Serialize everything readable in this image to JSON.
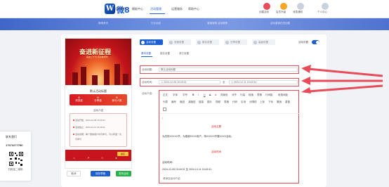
{
  "brand": {
    "logo_letter": "W",
    "logo_text": "微8"
  },
  "nav": {
    "items": [
      "用户首页",
      "模板中心",
      "活动管理",
      "运营服务",
      "帮助中心"
    ],
    "active": "活动管理"
  },
  "top_icons": [
    {
      "label": "创建活动",
      "icon": "gift-icon",
      "color": "#e84b5a"
    },
    {
      "label": "会员升级",
      "icon": "crown-icon",
      "color": "#f5a623"
    },
    {
      "label": "消息通知",
      "icon": "bell-icon",
      "color": "#9aa6b8"
    },
    {
      "label": "个人中心",
      "icon": "user-icon",
      "color": "#9aa6b8"
    }
  ],
  "banner_texts": [
    "新闻资讯",
    "行业动态",
    "营销案例 活动推荐",
    "活动营销在线创建"
  ],
  "preview": {
    "poster_title": "奋进新征程",
    "poster_subtitle": "喜迎二十大 共享新时代",
    "activity_title": "默认活动标题",
    "stats": [
      {
        "num": "0",
        "label": "浏览量"
      },
      {
        "num": "0",
        "label": "分享量"
      },
      {
        "num": "0",
        "label": "参与人数"
      }
    ],
    "section_title": "活动介绍",
    "info_lines": [
      "活动开始：2024-12-05 15:49:31",
      "活动截止：2024-12-11 15:49:31",
      "活动说明：每个微信用户均可参与，可以转发一次",
      "可参与"
    ],
    "footer_button": "报名",
    "footer_icons": [
      "home-icon",
      "share-icon",
      "star-icon",
      "user-icon"
    ]
  },
  "buttons": {
    "cancel": "取消",
    "save_draft": "保存草稿",
    "publish": "发布活动"
  },
  "steps": [
    {
      "label": "活动设置",
      "active": true
    },
    {
      "label": "页面设置",
      "active": false
    },
    {
      "label": "报名设置",
      "active": false
    },
    {
      "label": "分享设置",
      "active": false
    },
    {
      "label": "高级设置",
      "active": false
    }
  ],
  "switch_label": "活动设置",
  "subtabs": [
    "基本设置",
    "报名设置",
    "其它设置"
  ],
  "form": {
    "title_label": "活动标题：",
    "title_value": "默认活动标题",
    "time_label": "活动时间：",
    "start_time": "2024-12-05 15:49:31",
    "time_separator": "至",
    "end_time": "2024-12-11 15:49:31",
    "intro_label": "活动介绍："
  },
  "editor": {
    "toolbar_row1": [
      "正文",
      "字体",
      "字号",
      "B",
      "I",
      "U",
      "S",
      "A",
      "背景色",
      "对齐",
      "行高",
      "段落",
      "表情",
      "行间距",
      "段落间距"
    ],
    "toolbar_row2": [
      "列表",
      "编号",
      "缩进",
      "减缩进",
      "链接",
      "图片",
      "视频",
      "表格",
      "代码",
      "引用",
      "分隔线",
      "上标",
      "下标",
      "撤销",
      "重做"
    ],
    "heading1": "活动主题",
    "paragraph1": "为庆祝XXXXX节，为感谢XXXX用户，特XXXXX开展XXXX活动。",
    "heading2": "活动时间",
    "time_label": "活动时间：",
    "time_range": "2024-12-05 15:49:31 至 2024-12-11 15:49:31",
    "placeholder": "请添加活动介绍"
  },
  "contact": {
    "title": "联系我们",
    "phone": "17673277780",
    "qr_label": "扫码加二维码"
  },
  "colors": {
    "accent": "#1b5fd1",
    "highlight_frame": "#e84b5a",
    "promo_red": "#c8141c"
  }
}
